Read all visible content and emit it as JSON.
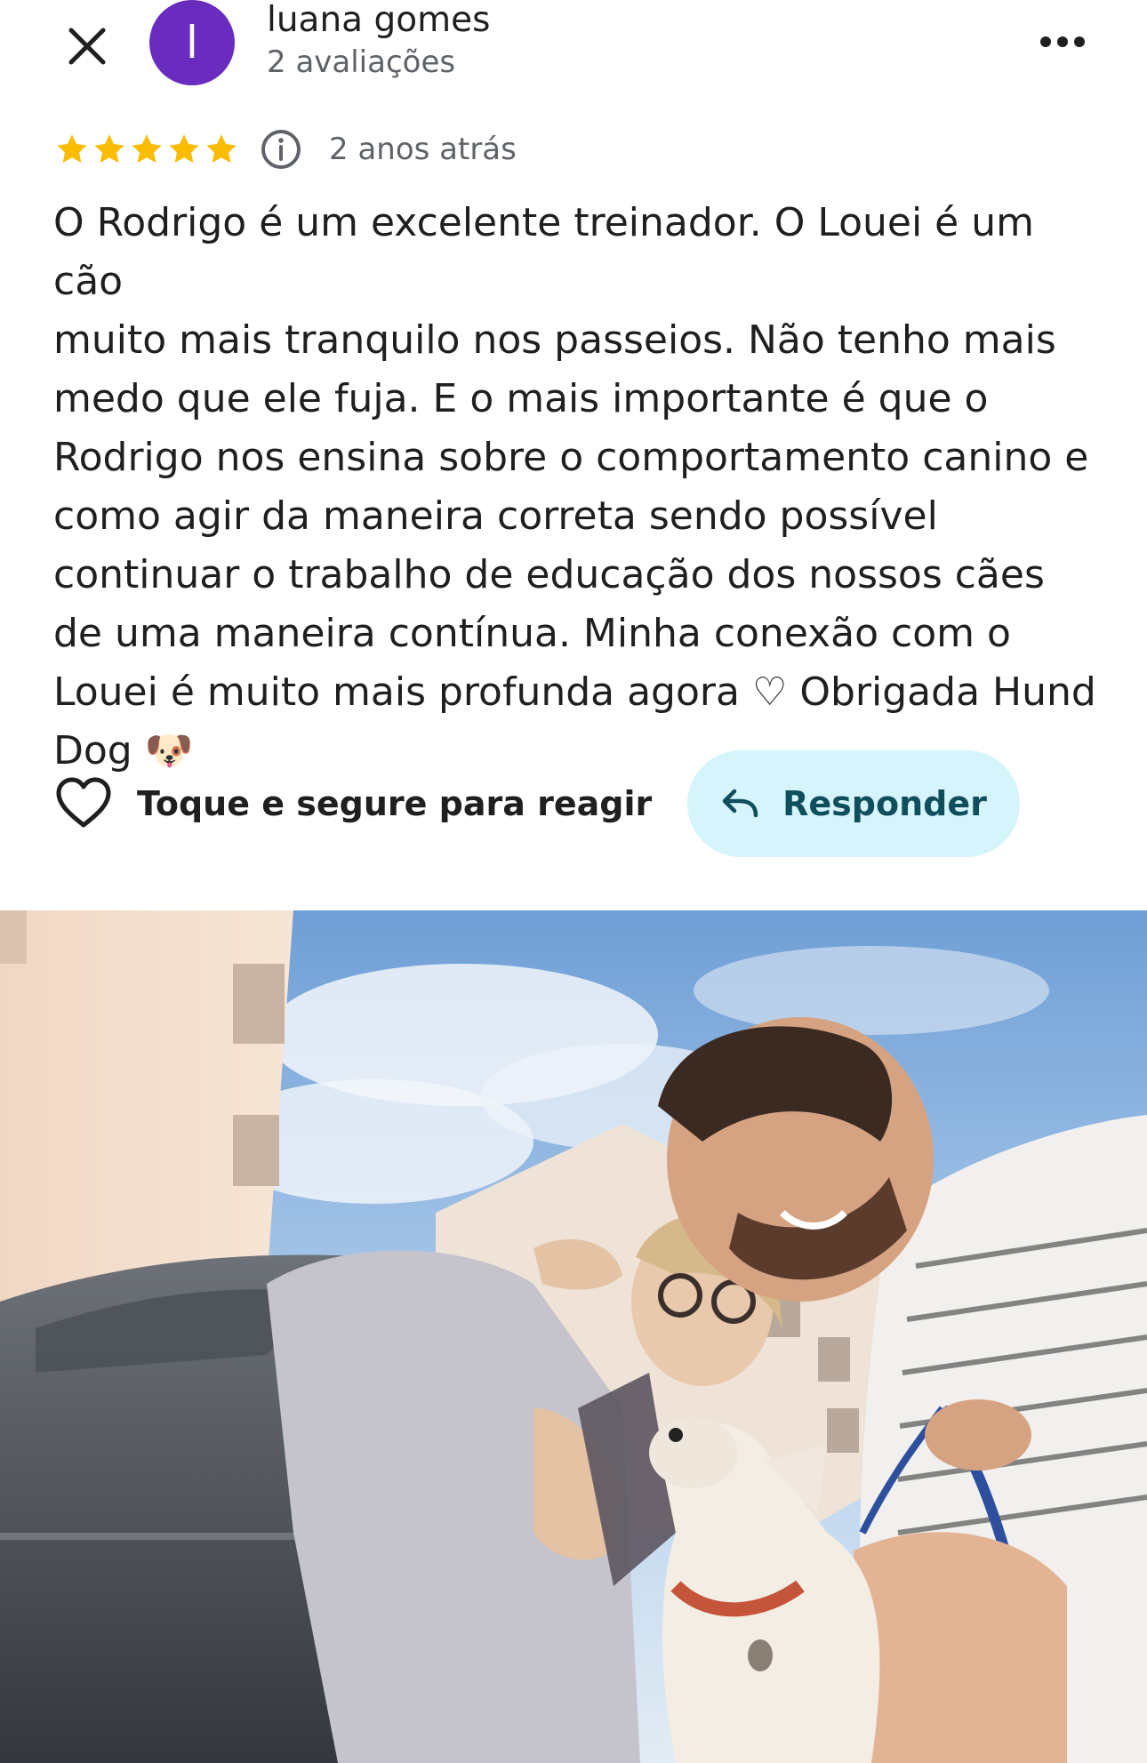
{
  "header": {
    "avatar_letter": "l",
    "user_name": "luana gomes",
    "review_count": "2 avaliações",
    "avatar_color": "#6a2bbf"
  },
  "rating": {
    "stars": 5,
    "max_stars": 5,
    "star_color": "#fbbc04",
    "age": "2 anos atrás"
  },
  "review": {
    "text": "O Rodrigo é um excelente treinador. O Louei é um cão\nmuito mais tranquilo nos passeios. Não tenho mais\nmedo que ele fuja. E o mais importante é que o\nRodrigo nos ensina sobre o comportamento canino e\ncomo agir da maneira correta sendo possível\ncontinuar o trabalho de educação dos nossos cães\nde uma maneira contínua. Minha conexão com o\nLouei é muito mais profunda agora ♡ Obrigada Hund\nDog 🐶"
  },
  "actions": {
    "react_label": "Toque e segure para reagir",
    "reply_label": "Responder",
    "reply_bg": "#d6f4fb"
  },
  "icons": {
    "close": "close-icon",
    "more": "more-horiz-icon",
    "info": "info-icon",
    "heart": "heart-outline-icon",
    "reply": "reply-arrow-icon"
  }
}
